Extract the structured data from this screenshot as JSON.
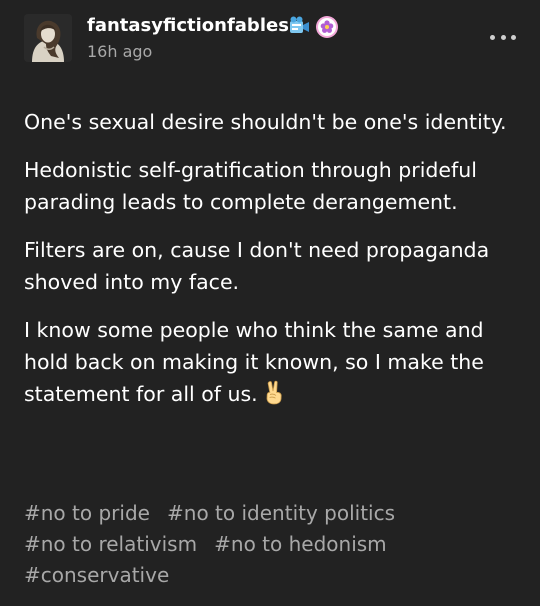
{
  "post": {
    "author": {
      "blog_name": "fantasyfictionfables",
      "avatar_icon": "avatar-portrait",
      "badges": [
        "film-camera-badge-icon",
        "pink-flower-badge-icon"
      ]
    },
    "timestamp": "16h ago",
    "menu_icon": "more-options-icon",
    "body": [
      "One's sexual desire shouldn't be one's identity.",
      "Hedonistic self-gratification through prideful parading leads to complete derangement.",
      "Filters are on, cause I don't need propaganda shoved into my face.",
      "I know some people who think the same and hold back on making it known, so I make the statement for all of us."
    ],
    "emoji": "victory-hand-emoji",
    "tags": [
      "#no to pride",
      "#no to identity politics",
      "#no to relativism",
      "#no to hedonism",
      "#conservative"
    ]
  },
  "colors": {
    "background": "#222222",
    "text": "#ffffff",
    "secondary_text": "#a8a8a8"
  }
}
